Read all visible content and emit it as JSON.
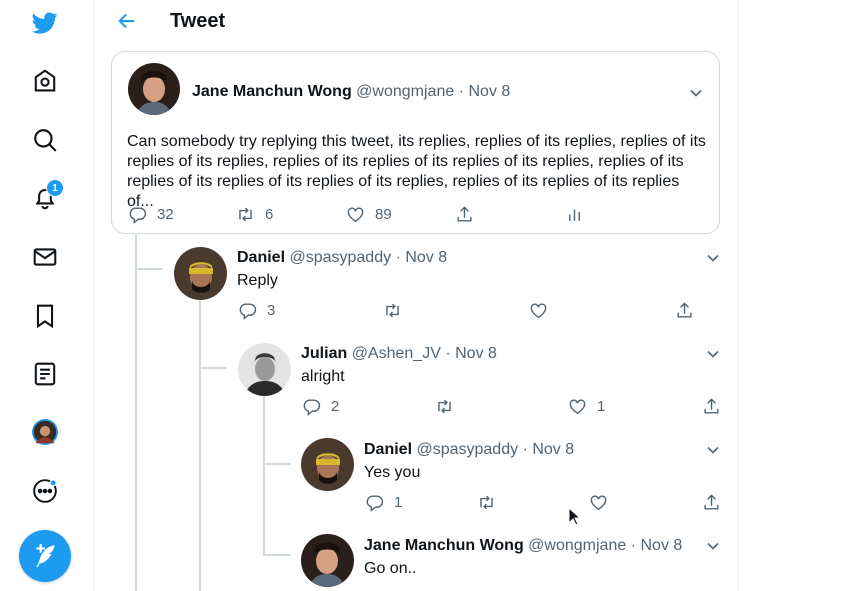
{
  "header": {
    "title": "Tweet"
  },
  "sidebar": {
    "notifications_badge": "1"
  },
  "main_tweet": {
    "name": "Jane Manchun Wong",
    "handle": "@wongmjane",
    "dot": "·",
    "date": "Nov 8",
    "text": "Can somebody try replying this tweet, its replies, replies of its replies, replies of its replies of its replies, replies of its replies of its replies of its replies, replies of its replies of its replies of its replies of its replies, replies of its replies of its replies of...",
    "replies": "32",
    "retweets": "6",
    "likes": "89"
  },
  "replies": [
    {
      "name": "Daniel",
      "handle": "@spasypaddy",
      "dot": "·",
      "date": "Nov 8",
      "text": "Reply",
      "replies": "3",
      "retweets": "",
      "likes": ""
    },
    {
      "name": "Julian",
      "handle": "@Ashen_JV",
      "dot": "·",
      "date": "Nov 8",
      "text": "alright",
      "replies": "2",
      "retweets": "",
      "likes": "1"
    },
    {
      "name": "Daniel",
      "handle": "@spasypaddy",
      "dot": "·",
      "date": "Nov 8",
      "text": "Yes you",
      "replies": "1",
      "retweets": "",
      "likes": ""
    },
    {
      "name": "Jane Manchun Wong",
      "handle": "@wongmjane",
      "dot": "·",
      "date": "Nov 8",
      "text": "Go on..",
      "replies": "",
      "retweets": "",
      "likes": ""
    }
  ],
  "colors": {
    "accent": "#1d9bf0",
    "secondary_text": "#536471",
    "border": "#cfd9de"
  }
}
